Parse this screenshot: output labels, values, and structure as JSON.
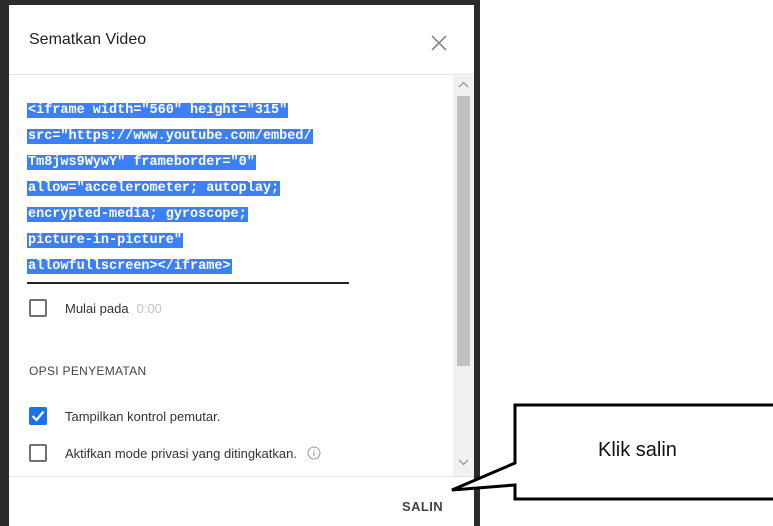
{
  "dialog": {
    "title": "Sematkan Video",
    "code_lines": [
      "<iframe width=\"560\" height=\"315\"",
      "src=\"https://www.youtube.com/embed/",
      "Tm8jws9WywY\" frameborder=\"0\"",
      "allow=\"accelerometer; autoplay;",
      "encrypted-media; gyroscope;",
      "picture-in-picture\"",
      "allowfullscreen></iframe>"
    ],
    "start_at": {
      "label": "Mulai pada",
      "time": "0:00",
      "checked": false
    },
    "section_label": "OPSI PENYEMATAN",
    "options": [
      {
        "label": "Tampilkan kontrol pemutar.",
        "checked": true
      },
      {
        "label": "Aktifkan mode privasi yang ditingkatkan.",
        "checked": false
      }
    ],
    "copy_button": "SALIN"
  },
  "callout": {
    "text": "Klik salin"
  },
  "colors": {
    "selection": "#3b80f6",
    "checkbox_checked": "#1a73e8"
  },
  "icons": [
    "close-icon",
    "check-icon",
    "info-icon",
    "chevron-up-icon",
    "chevron-down-icon"
  ]
}
